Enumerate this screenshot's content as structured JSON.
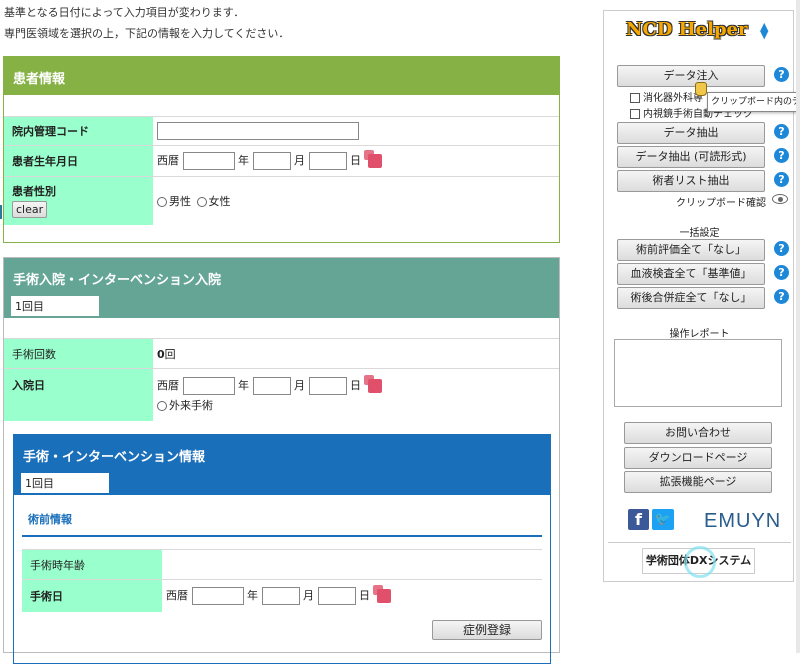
{
  "intro": {
    "line1": "基準となる日付によって入力項目が変わります．",
    "line2": "専門医領域を選択の上，下記の情報を入力してください．"
  },
  "patient": {
    "header": "患者情報",
    "code_label": "院内管理コード",
    "code_value": "",
    "dob_label": "患者生年月日",
    "era": "西暦",
    "year": "年",
    "month": "月",
    "day": "日",
    "sex_label": "患者性別",
    "clear": "clear",
    "male": "男性",
    "female": "女性"
  },
  "admission": {
    "header": "手術入院・インターベンション入院",
    "tab": "1回目",
    "count_label": "手術回数",
    "count_value": "0",
    "count_unit": "回",
    "date_label": "入院日",
    "era": "西暦",
    "year": "年",
    "month": "月",
    "day": "日",
    "outpatient": "外来手術"
  },
  "surgery": {
    "header": "手術・インターベンション情報",
    "tab": "1回目",
    "preop_title": "術前情報",
    "age_label": "手術時年齢",
    "date_label": "手術日",
    "era": "西暦",
    "year": "年",
    "month": "月",
    "day": "日",
    "register": "症例登録"
  },
  "helper": {
    "logo": "NCD Helper",
    "data_inject": "データ注入",
    "chk1": "消化器外科専",
    "chk2": "内視鏡手術自動チェック",
    "data_extract": "データ抽出",
    "data_extract_readable": "データ抽出 (可読形式)",
    "surgeon_list": "術者リスト抽出",
    "clipboard_check": "クリップボード確認",
    "bulk_title": "一括設定",
    "bulk1": "術前評価全て「なし」",
    "bulk2": "血液検査全て「基準値」",
    "bulk3": "術後合併症全て「なし」",
    "report_title": "操作レポート",
    "report_text": "",
    "contact": "お問い合わせ",
    "download": "ダウンロードページ",
    "extension": "拡張機能ページ",
    "brand": "EMUYN",
    "dx": "学術団体DXシステム",
    "tooltip": "クリップボード内のデータ"
  },
  "colors": {
    "green_header": "#86b144",
    "teal_header": "#64a596",
    "blue_header": "#1a6fba",
    "label_bg": "#99ffcc",
    "help_icon": "#1e88d8"
  }
}
